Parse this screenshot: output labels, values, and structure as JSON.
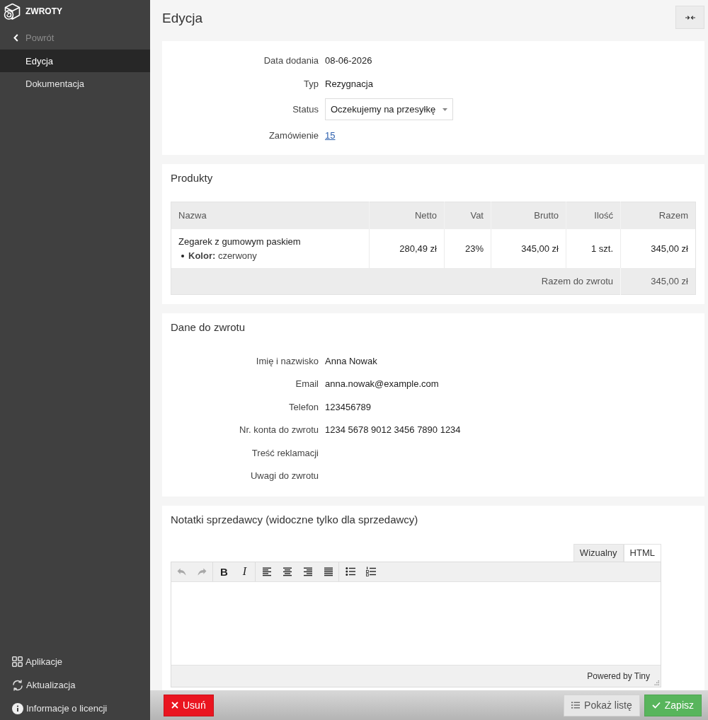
{
  "sidebar": {
    "app_title": "ZWROTY",
    "back": "Powrót",
    "items": [
      {
        "label": "Edycja",
        "selected": true
      },
      {
        "label": "Dokumentacja",
        "selected": false
      }
    ],
    "footer_items": [
      {
        "label": "Aplikacje",
        "kind": "apps"
      },
      {
        "label": "Aktualizacja",
        "kind": "update"
      },
      {
        "label": "Informacje o licencji",
        "kind": "info"
      }
    ]
  },
  "header": {
    "title": "Edycja"
  },
  "details": [
    {
      "label": "Data dodania",
      "value": "08-06-2026",
      "kind": "text"
    },
    {
      "label": "Typ",
      "value": "Rezygnacja",
      "kind": "text"
    },
    {
      "label": "Status",
      "value": "Oczekujemy na przesyłkę",
      "kind": "select"
    },
    {
      "label": "Zamówienie",
      "value": "15",
      "kind": "link"
    }
  ],
  "products": {
    "title": "Produkty",
    "columns": [
      "Nazwa",
      "Netto",
      "Vat",
      "Brutto",
      "Ilość",
      "Razem"
    ],
    "rows": [
      {
        "cells": [
          "Zegarek z gumowym paskiem",
          "280,49 zł",
          "23%",
          "345,00 zł",
          "1 szt.",
          "345,00 zł"
        ],
        "attributes": [
          "**Kolor:** czerwony"
        ]
      }
    ],
    "total_label": "Razem do zwrotu",
    "total_value": "345,00 zł"
  },
  "return_data": {
    "title": "Dane do zwrotu",
    "fields": [
      {
        "label": "Imię i nazwisko",
        "value": "Anna Nowak"
      },
      {
        "label": "Email",
        "value": "anna.nowak@example.com"
      },
      {
        "label": "Telefon",
        "value": "123456789"
      },
      {
        "label": "Nr. konta do zwrotu",
        "value": "1234 5678 9012 3456 7890 1234"
      },
      {
        "label": "Treść reklamacji"
      },
      {
        "label": "Uwagi do zwrotu"
      }
    ]
  },
  "notes": {
    "title": "Notatki sprzedawcy (widoczne tylko dla sprzedawcy)",
    "editor_tabs": [
      {
        "label": "Wizualny",
        "selected": true
      },
      {
        "label": "HTML",
        "selected": false
      }
    ],
    "toolbar": [
      {
        "buttons": [
          {
            "kind": "undo",
            "disabled": true
          },
          {
            "kind": "redo",
            "disabled": true
          }
        ]
      },
      {
        "buttons": [
          {
            "kind": "bold",
            "glyph": "B",
            "disabled": false
          },
          {
            "kind": "italic",
            "glyph": "I",
            "disabled": false
          }
        ]
      },
      {
        "buttons": [
          {
            "kind": "align-left",
            "disabled": false
          },
          {
            "kind": "align-center",
            "disabled": false
          },
          {
            "kind": "align-right",
            "disabled": false
          },
          {
            "kind": "justify",
            "disabled": false
          }
        ]
      },
      {
        "buttons": [
          {
            "kind": "bullet-list",
            "disabled": false
          },
          {
            "kind": "numbered-list",
            "disabled": false
          }
        ]
      }
    ],
    "status_text": "Powered by Tiny"
  },
  "actions": [
    {
      "label": "Usuń",
      "kind": "danger"
    },
    {
      "label": "Pokaż listę",
      "kind": "secondary"
    },
    {
      "label": "Zapisz",
      "kind": "primary"
    }
  ]
}
